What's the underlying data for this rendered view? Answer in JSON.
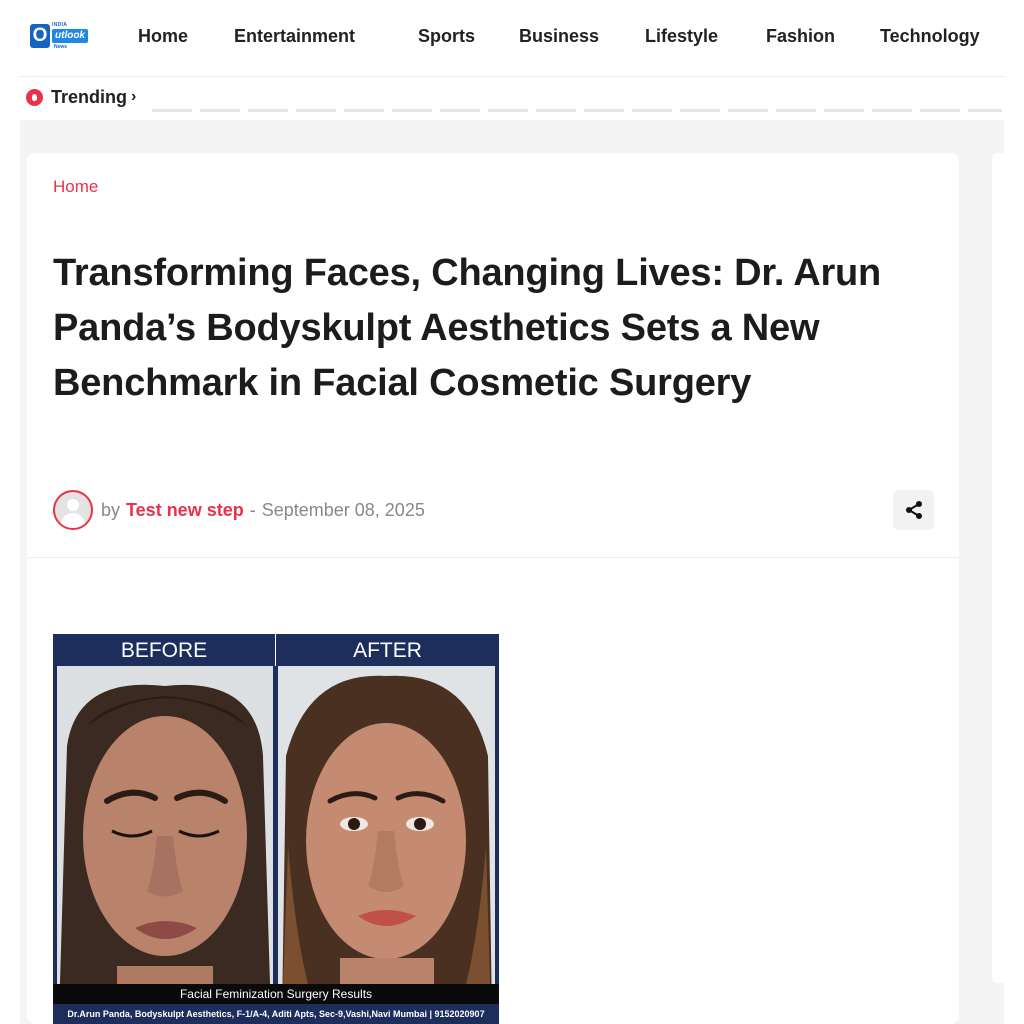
{
  "header": {
    "logo": {
      "top_text": "INDIA",
      "word": "utlook",
      "letter": "O",
      "bottom_text": "News"
    },
    "nav": [
      "Home",
      "Entertainment",
      "Sports",
      "Business",
      "Lifestyle",
      "Fashion",
      "Technology"
    ]
  },
  "trending": {
    "label": "Trending",
    "chevron": "›"
  },
  "breadcrumb": "Home",
  "article": {
    "title": "Transforming Faces, Changing Lives: Dr. Arun Panda’s Bodyskulpt Aesthetics Sets a New Benchmark in Facial Cosmetic Surgery",
    "by": "by",
    "author": "Test new step",
    "separator": "-",
    "date": "September 08, 2025"
  },
  "image": {
    "before_label": "BEFORE",
    "after_label": "AFTER",
    "caption": "Facial Feminization Surgery Results",
    "footer": "Dr.Arun Panda, Bodyskulpt Aesthetics, F-1/A-4, Aditi Apts, Sec-9,Vashi,Navi Mumbai | 9152020907"
  },
  "colors": {
    "accent": "#e8334a",
    "navy": "#1d2d5c",
    "logo_blue": "#1565c0"
  },
  "icons": {
    "trending": "flame-icon",
    "share": "share-icon",
    "avatar": "user-avatar-icon"
  }
}
